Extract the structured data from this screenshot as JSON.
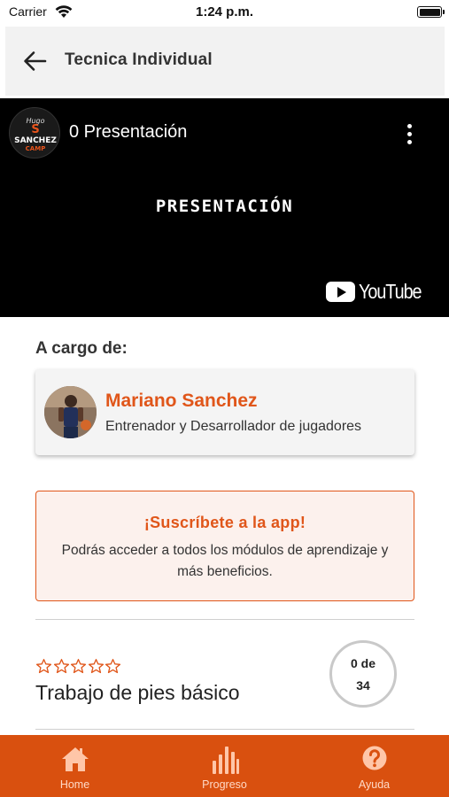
{
  "status_bar": {
    "carrier": "Carrier",
    "time": "1:24 p.m."
  },
  "header": {
    "title": "Tecnica Individual"
  },
  "video": {
    "title": "0 Presentación",
    "overlay_text": "PRESENTACIÓN",
    "youtube_label": "YouTube",
    "channel_logo_text": [
      "Hugo",
      "S",
      "SANCHEZ",
      "CAMP"
    ]
  },
  "coach_section": {
    "label": "A cargo de:",
    "name": "Mariano Sanchez",
    "role": "Entrenador y Desarrollador de jugadores"
  },
  "promo": {
    "title": "¡Suscríbete a la app!",
    "text": "Podrás acceder a todos los módulos de aprendizaje y más beneficios."
  },
  "module": {
    "title": "Trabajo de pies básico",
    "rating": 0,
    "rating_max": 5,
    "progress_line1": "0 de",
    "progress_line2": "34"
  },
  "tabs": [
    {
      "label": "Home",
      "icon": "home-icon"
    },
    {
      "label": "Progreso",
      "icon": "bar-chart-icon"
    },
    {
      "label": "Ayuda",
      "icon": "help-icon"
    }
  ],
  "colors": {
    "accent": "#e0561a",
    "tab_bar": "#d9500f",
    "promo_bg": "#fcf1ed",
    "header_bg": "#f2f2f2"
  }
}
